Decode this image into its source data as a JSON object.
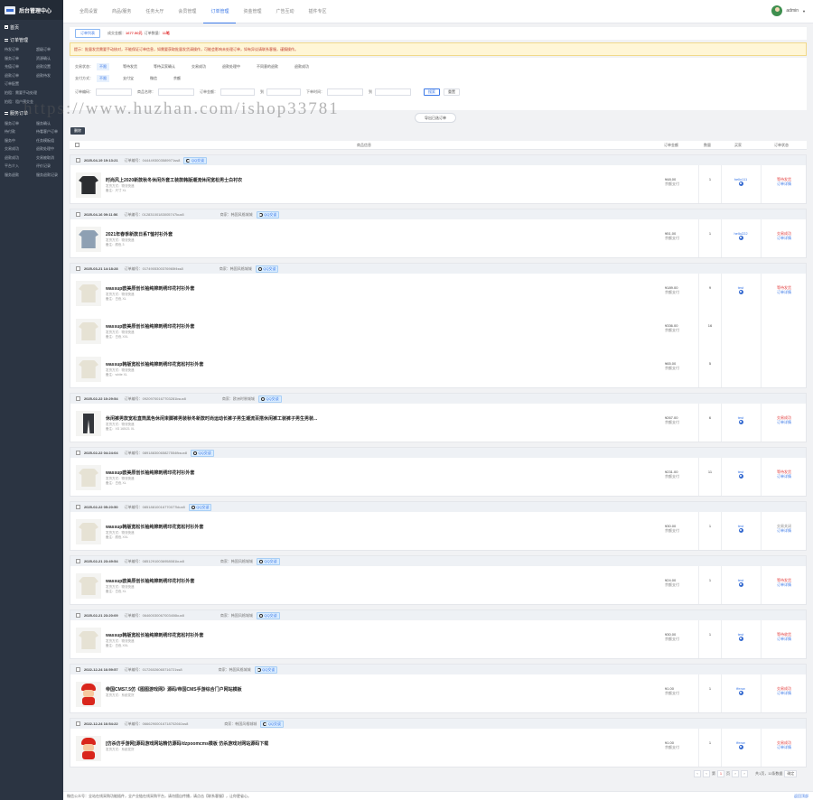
{
  "sidebar": {
    "title": "后台管理中心",
    "home": "首页",
    "section1": "订单管理",
    "section2": "服务订单",
    "group1": [
      "待发订单",
      "超级订单",
      "服务订单",
      "资源确认",
      "充值订单",
      "退款设置",
      "退款订单",
      "退款待发",
      "订单配置"
    ],
    "group1b": [
      "拍租：需要手动处理",
      "拍租：租户预交金"
    ],
    "group2": [
      "服务订单",
      "服务确认",
      "待付款",
      "待看客户订单",
      "服务中",
      "任务模板组",
      "交易成功",
      "退款处理中",
      "退款成功",
      "交易被取消",
      "平台介入",
      "评价记录",
      "服务退款",
      "服务退款记录"
    ]
  },
  "topbar": {
    "tabs": [
      "全局设置",
      "商品/服务",
      "任务大厅",
      "会员管理",
      "订单管理",
      "资金管理",
      "广告互动",
      "插件专区"
    ],
    "active": 4,
    "user": "admin"
  },
  "subtab": "订单列表",
  "summary": {
    "label1": "成交金额：",
    "amount": "1677.50元",
    "label2": "订单数量：",
    "count": "11笔"
  },
  "notice": "提示：批量发货需要手动核对，不能保证订单信息，如需要获取批量发货请操作，可能会影响未处理订单，如有异议请联系客服，谨慎操作。",
  "filters": {
    "status_label": "交易状态：",
    "status": [
      "不限",
      "等待发货",
      "等待买家确认",
      "交易成功",
      "退款处理中",
      "不同意的退款",
      "退款成功"
    ],
    "pay_label": "支付方式：",
    "pay": [
      "不限",
      "支付宝",
      "微信",
      "余额"
    ],
    "s1": "订单编码：",
    "s2": "商品名称：",
    "s3": "订单金额：",
    "to": "到",
    "s4": "下单时间：",
    "search": "搜索",
    "reset": "重置"
  },
  "watermark": "https://www.huzhan.com/ishop33781",
  "export": "导出已选订单",
  "batch": "删除",
  "thead": {
    "item": "商品信息",
    "price": "订单金额",
    "qty": "数量",
    "buyer": "买家",
    "status": "订单状态"
  },
  "orders": [
    {
      "date": "2025-04-19 19:13:21",
      "no": "订单编号：0444493003589971ss8",
      "shop": "",
      "items": [
        {
          "t": "时尚风上2020新款秋冬休闲外套工装款韩版潮流休闲宽松男士白衬衣",
          "s": [
            "发货方式：物流快递",
            "备注：尺寸 XL"
          ],
          "p": "¥48.00",
          "pay": "余额支付",
          "q": "1",
          "img": "dark"
        }
      ],
      "buyer": "hello111",
      "st": "等待发货",
      "st2": "订单详情",
      "cls": "st-red"
    },
    {
      "date": "2025-04-16 09:11:56",
      "no": "订单编号：01283100183005747kux8",
      "shop": "商家：韩国风格城城",
      "items": [
        {
          "t": "2021年春季新款日系T恤衬衫外套",
          "s": [
            "发货方式：物流快递",
            "备注：颜色 3"
          ],
          "p": "¥51.00",
          "pay": "余额支付",
          "q": "1",
          "img": "grey"
        }
      ],
      "buyer": "hello222",
      "st": "交易成功",
      "st2": "订单详情",
      "cls": "st-red"
    },
    {
      "date": "2025-03-21 14:18:28",
      "no": "订单编号：0174905300376965f4ss8",
      "shop": "商家：韩国风格城城",
      "items": [
        {
          "t": "wassup欧美原创长袖纯棉刺绣印花衬衫外套",
          "s": [
            "发货方式：物流快递",
            "备注：白色 XL"
          ],
          "p": "¥189.00",
          "pay": "余额支付",
          "q": "9",
          "img": "light"
        },
        {
          "t": "wassup欧美原创长袖纯棉刺绣印花衬衫外套",
          "s": [
            "发货方式：物流快递",
            "备注：白色 XXL"
          ],
          "p": "¥336.00",
          "pay": "余额支付",
          "q": "16",
          "img": "light"
        },
        {
          "t": "wassup韩版宽松长袖纯棉刺绣印花宽松衬衫外套",
          "s": [
            "发货方式：物流快递",
            "备注：white XL"
          ],
          "p": "¥65.00",
          "pay": "余额支付",
          "q": "5",
          "img": "light"
        }
      ],
      "buyer": "test",
      "st": "等待发货",
      "st2": "订单详情",
      "cls": "st-red"
    },
    {
      "date": "2025-02-22 10:29:54",
      "no": "订单编号：09209700167703281ksux8",
      "shop": "商家：欧洲时装城城",
      "items": [
        {
          "t": "休闲裤男款宽松直筒黑色休闲束脚裤男装秋冬新款时尚运动长裤子男生潮流百搭休闲裤工装裤子男生男装...",
          "s": [
            "发货方式：物流快递",
            "备注：XS 165/21 XL"
          ],
          "p": "¥267.00",
          "pay": "余额支付",
          "q": "6",
          "img": "pants"
        }
      ],
      "buyer": "test",
      "st": "交易成功",
      "st2": "订单详情",
      "cls": "st-red"
    },
    {
      "date": "2025-02-22 04:24:04",
      "no": "订单编号：08918830065827554fksux8",
      "shop": "",
      "items": [
        {
          "t": "wassup欧美原创长袖纯棉刺绣印花衬衫外套",
          "s": [
            "发货方式：物流快递",
            "备注：白色 XL"
          ],
          "p": "¥231.00",
          "pay": "余额支付",
          "q": "11",
          "img": "light"
        }
      ],
      "buyer": "test",
      "st": "等待发货",
      "st2": "订单详情",
      "cls": "st-red"
    },
    {
      "date": "2025-02-22 05:20:50",
      "no": "订单编号：08518810016770077klux8",
      "shop": "",
      "items": [
        {
          "t": "wassup韩版宽松长袖纯棉刺绣印花宽松衬衫外套",
          "s": [
            "发货方式：物流快递",
            "备注：颜色 XXL"
          ],
          "p": "¥30.00",
          "pay": "余额支付",
          "q": "1",
          "img": "light"
        }
      ],
      "buyer": "test",
      "st": "交易关闭",
      "st2": "订单详情",
      "cls": "st-gray"
    },
    {
      "date": "2025-02-21 23:49:54",
      "no": "订单编号：08512910036958081kux8",
      "shop": "商家：韩国风格城城",
      "items": [
        {
          "t": "wassup欧美原创长袖纯棉刺绣印花衬衫外套",
          "s": [
            "发货方式：物流快递",
            "备注：白色 XL"
          ],
          "p": "¥24.00",
          "pay": "余额支付",
          "q": "1",
          "img": "light"
        }
      ],
      "buyer": "test",
      "st": "等待发货",
      "st2": "订单详情",
      "cls": "st-red"
    },
    {
      "date": "2025-02-21 23:20:09",
      "no": "订单编号：06460030067003406kux8",
      "shop": "商家：韩国风格城城",
      "items": [
        {
          "t": "wassup韩版宽松长袖纯棉刺绣印花宽松衬衫外套",
          "s": [
            "发货方式：物流快递",
            "备注：白色 XXL"
          ],
          "p": "¥30.00",
          "pay": "余额支付",
          "q": "1",
          "img": "light"
        }
      ],
      "buyer": "test",
      "st": "等待收货",
      "st2": "订单详情",
      "cls": "st-red"
    },
    {
      "date": "2022-12-24 16:59:57",
      "no": "订单编号：01726026065716721ss8",
      "shop": "商家：韩国风格城城",
      "items": [
        {
          "t": "帝国CMS7.5仿《图图游戏网》源码/帝国CMS手游综合门户网站模板",
          "s": [
            "发货方式：系统发货"
          ],
          "p": "¥1.00",
          "pay": "余额支付",
          "q": "1",
          "img": "mario"
        }
      ],
      "buyer": "ffenw",
      "st": "交易成功",
      "st2": "订单详情",
      "cls": "st-red"
    },
    {
      "date": "2022-12-24 16:54:22",
      "no": "订单编号：06662900016718702661ss8",
      "shop": "商家：韩国风格城城",
      "items": [
        {
          "t": "[仿杀仿手游网]源码游戏网站精仿源码/dzpoomcms模板 仿杀游戏对网站源码下载",
          "s": [
            "发货方式：系统发货"
          ],
          "p": "¥1.00",
          "pay": "余额支付",
          "q": "1",
          "img": "mario"
        }
      ],
      "buyer": "ffenw",
      "st": "交易成功",
      "st2": "订单详情",
      "cls": "st-red"
    }
  ],
  "pager": {
    "prev": "‹",
    "first": "第",
    "page": "1",
    "last": "页",
    "next": "›",
    "info": "共1页，11条数据",
    "go": "确定"
  },
  "footer": "微信公众号：全站在线采购功能插件，全产业链在线采购平台，请勿擅自传播，请点击【联系客服】，让你更省心。",
  "footer_right": "返回顶部"
}
